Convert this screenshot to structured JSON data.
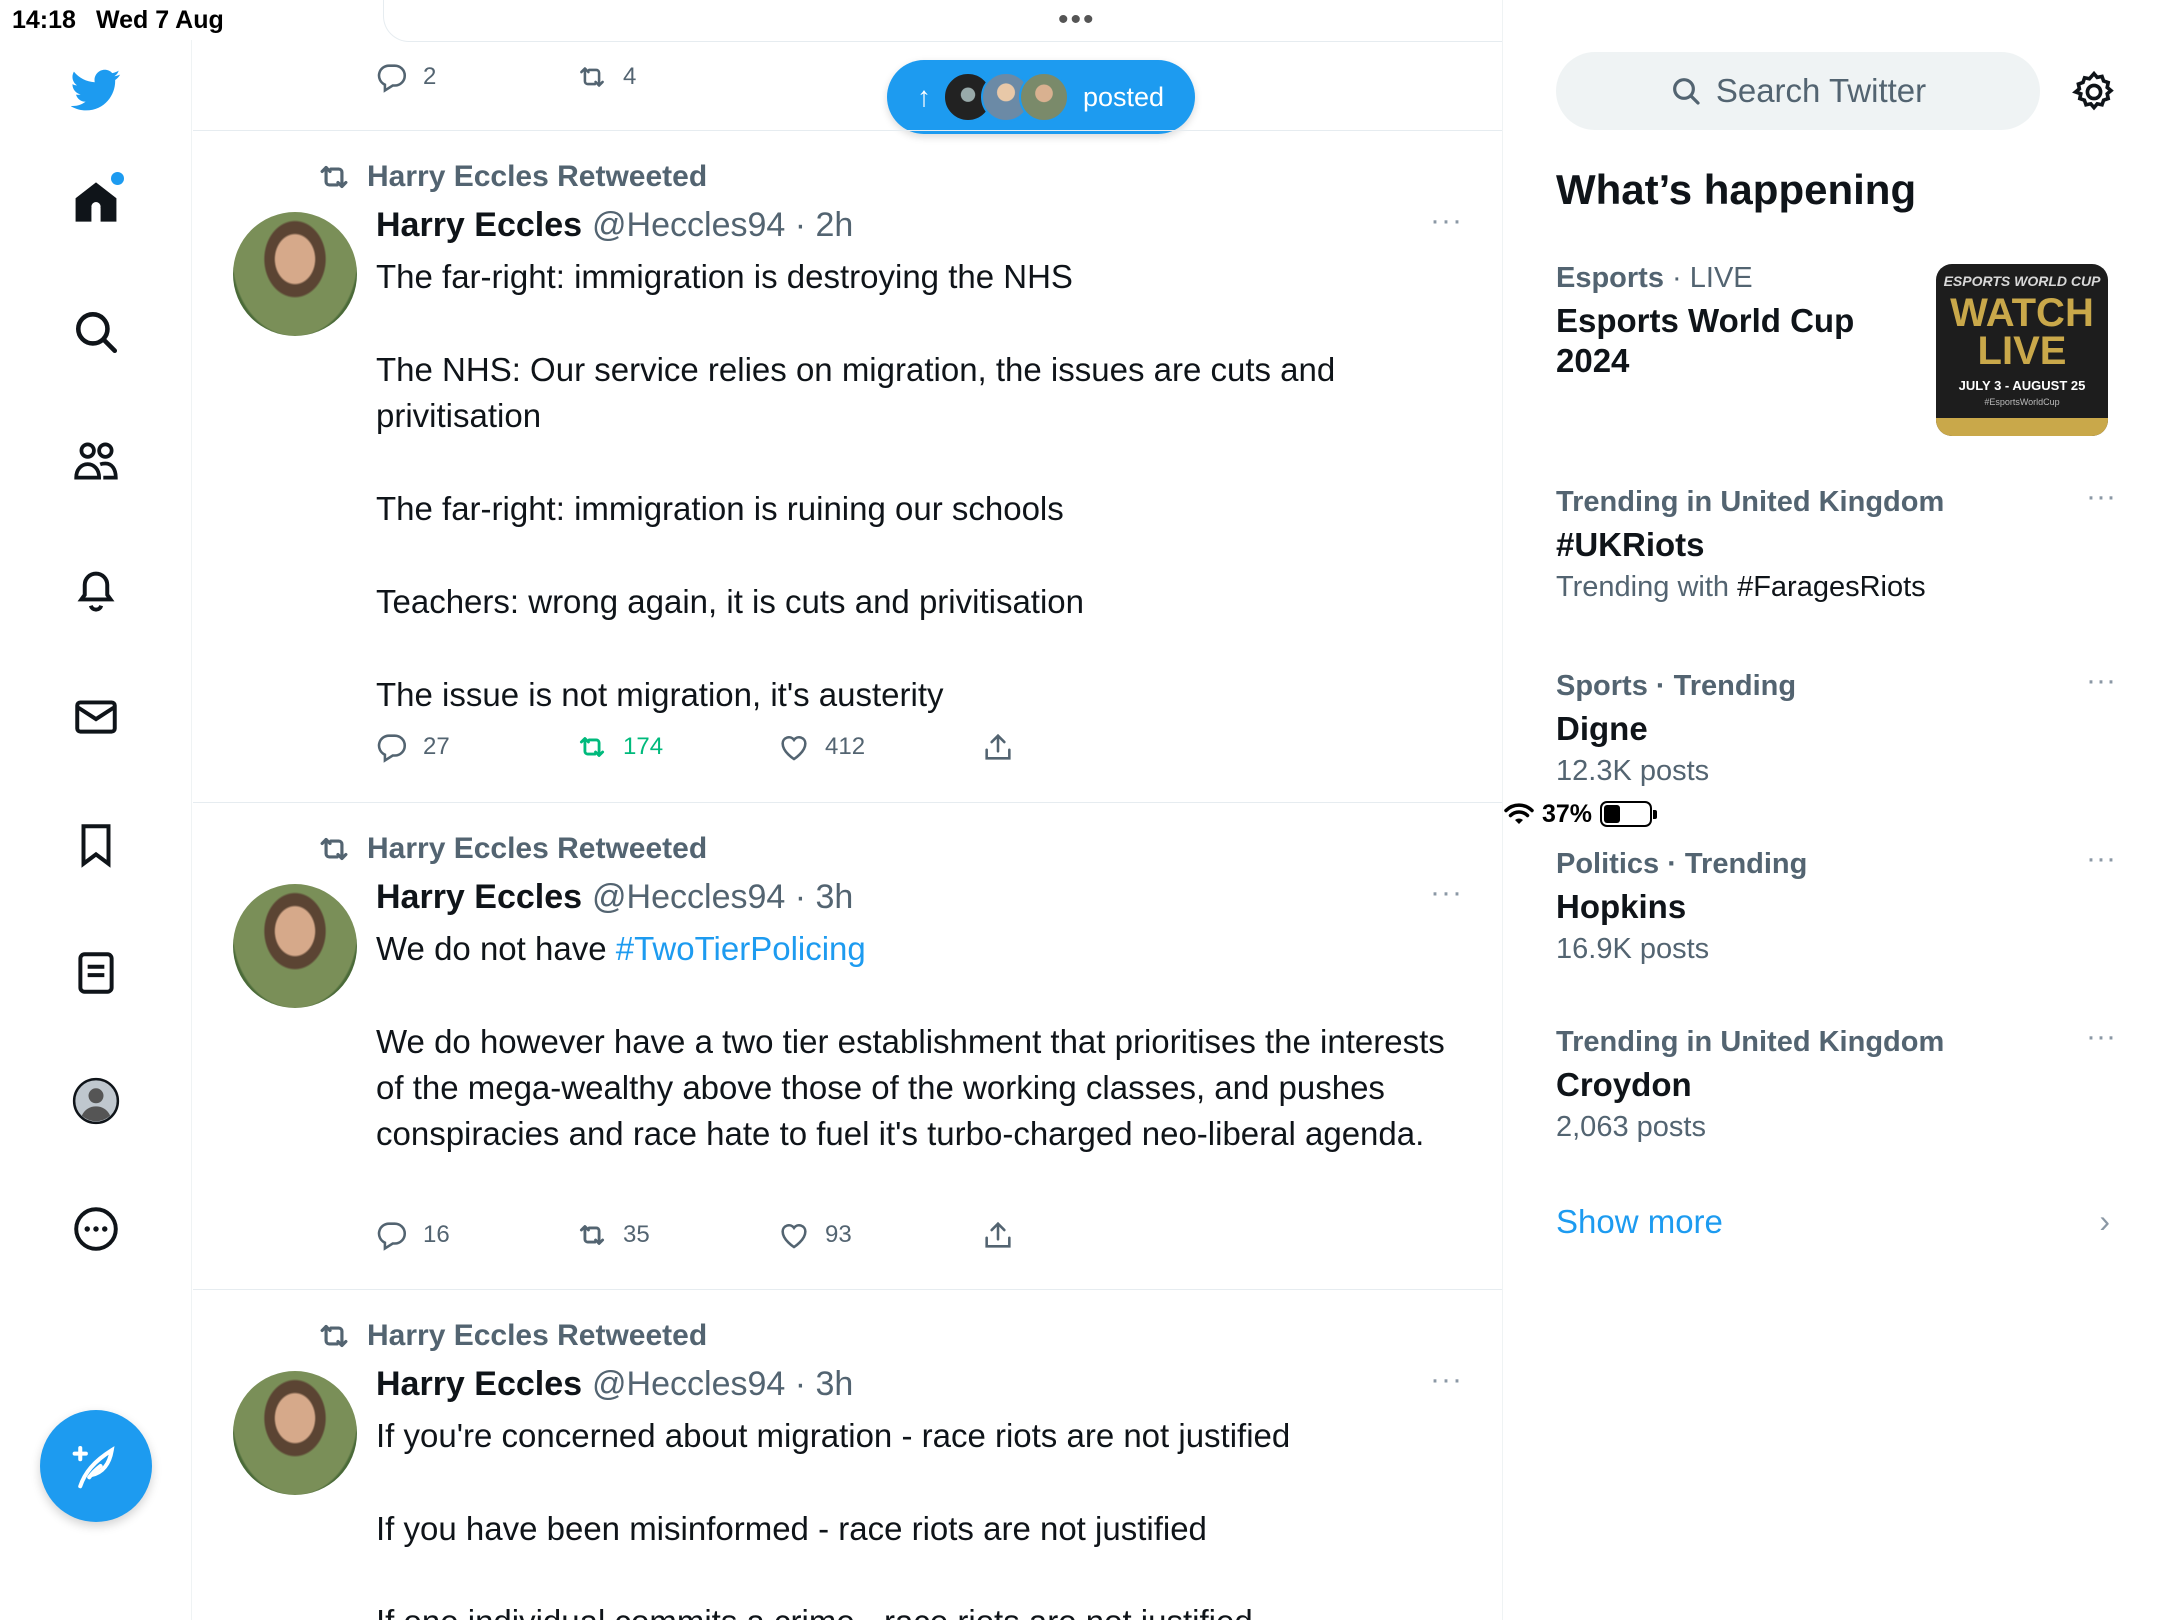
{
  "status_bar": {
    "time": "14:18",
    "date": "Wed 7 Aug",
    "multitask_dots": "•••",
    "battery_percent": "37%",
    "battery_level": 0.37
  },
  "nav": {
    "items": [
      {
        "name": "twitter-logo-icon"
      },
      {
        "name": "home-icon"
      },
      {
        "name": "explore-search-icon"
      },
      {
        "name": "communities-icon"
      },
      {
        "name": "notifications-bell-icon"
      },
      {
        "name": "messages-envelope-icon"
      },
      {
        "name": "bookmarks-icon"
      },
      {
        "name": "lists-icon"
      },
      {
        "name": "profile-avatar-icon"
      },
      {
        "name": "more-options-icon"
      }
    ],
    "compose_icon": "compose-feather-icon"
  },
  "feed": {
    "top_tweet_actions": {
      "replies": "2",
      "retweets": "4"
    },
    "posted_pill": {
      "arrow": "↑",
      "label": "posted"
    },
    "tweets": [
      {
        "retweeted_by": "Harry Eccles Retweeted",
        "name": "Harry Eccles",
        "handle_time": "@Heccles94 · 2h",
        "more": "···",
        "body": [
          "The far-right: immigration is destroying the NHS",
          "The NHS: Our service relies on migration, the issues are cuts and privitisation",
          "The far-right: immigration is ruining our schools",
          "Teachers: wrong again, it is cuts and privitisation",
          "The issue is not migration, it's austerity"
        ],
        "replies": "27",
        "retweets": "174",
        "likes": "412"
      },
      {
        "retweeted_by": "Harry Eccles Retweeted",
        "name": "Harry Eccles",
        "handle_time": "@Heccles94 · 3h",
        "more": "···",
        "body_prefix": "We do not have ",
        "hashtag": "#TwoTierPolicing",
        "body": [
          "We do however have a two tier establishment that prioritises the interests of the mega-wealthy above those of the working classes, and pushes conspiracies and race hate to fuel it's turbo-charged neo-liberal agenda."
        ],
        "replies": "16",
        "retweets": "35",
        "likes": "93"
      },
      {
        "retweeted_by": "Harry Eccles Retweeted",
        "name": "Harry Eccles",
        "handle_time": "@Heccles94 · 3h",
        "more": "···",
        "body": [
          "If you're concerned about migration - race riots are not justified",
          "If you have been misinformed - race riots are not justified",
          "If one individual commits a crime - race riots are not justified"
        ]
      }
    ]
  },
  "sidebar": {
    "search_placeholder": "Search Twitter",
    "heading": "What’s happening",
    "trends": [
      {
        "context": "Esports",
        "context_extra": " · LIVE",
        "title": "Esports World Cup 2024",
        "sub": ""
      },
      {
        "context": "Trending in United Kingdom",
        "title": "#UKRiots",
        "sub_prefix": "Trending with ",
        "sub_tag": "#FaragesRiots",
        "more": "···"
      },
      {
        "context": "Sports · Trending",
        "title": "Digne",
        "sub": "12.3K posts",
        "more": "···"
      },
      {
        "context": "Politics · Trending",
        "title": "Hopkins",
        "sub": "16.9K posts",
        "more": "···"
      },
      {
        "context": "Trending in United Kingdom",
        "title": "Croydon",
        "sub": "2,063 posts",
        "more": "···"
      }
    ],
    "thumbnail": {
      "line1": "ESPORTS WORLD CUP",
      "line2": "WATCH LIVE",
      "line3": "JULY 3 - AUGUST 25",
      "line4": "#EsportsWorldCup"
    },
    "show_more": "Show more",
    "show_more_chevron": "›"
  },
  "colors": {
    "accent": "#1d9bf0",
    "retweet_active": "#00ba7c",
    "secondary_text": "#536471"
  }
}
